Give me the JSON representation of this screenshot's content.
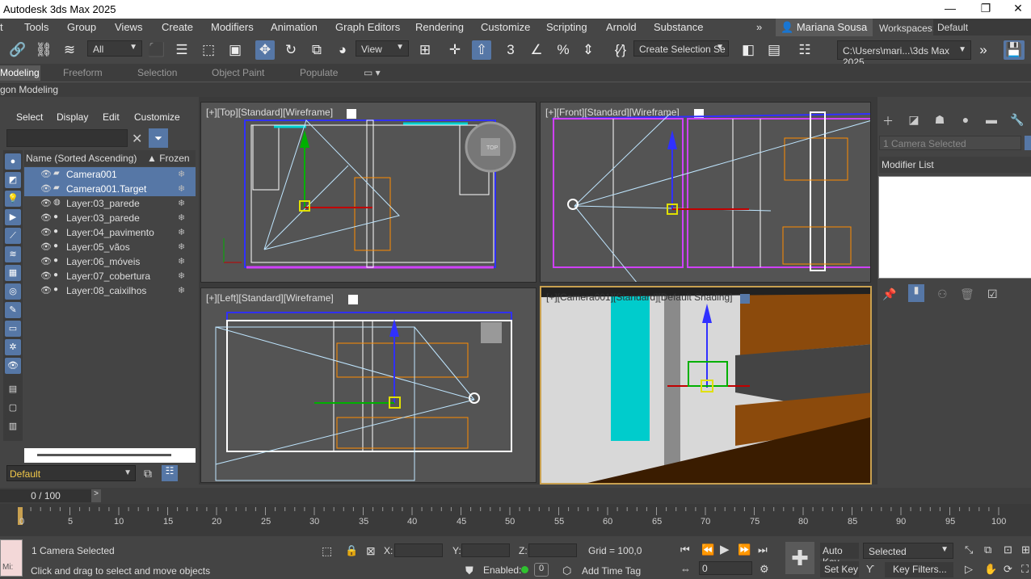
{
  "title": "Autodesk 3ds Max 2025",
  "menu": [
    "Tools",
    "Group",
    "Views",
    "Create",
    "Modifiers",
    "Animation",
    "Graph Editors",
    "Rendering",
    "Customize",
    "Scripting",
    "Arnold",
    "Substance"
  ],
  "user": "Mariana Sousa ▾",
  "workspace_label": "Workspaces:",
  "workspace": "Default",
  "toolbar": {
    "filter": "All",
    "refcoord": "View",
    "selset": "Create Selection Se",
    "path": "C:\\Users\\mari...\\3ds Max 2025"
  },
  "ribbon_tabs": [
    "Modeling",
    "Freeform",
    "Selection",
    "Object Paint",
    "Populate"
  ],
  "ribbon_sub": "gon Modeling",
  "scene": {
    "tabs": [
      "Select",
      "Display",
      "Edit",
      "Customize"
    ],
    "col_name": "Name (Sorted Ascending)",
    "col_frozen": "▲ Frozen",
    "layer": "Default",
    "rows": [
      "Camera001",
      "Camera001.Target",
      "Layer:03_parede",
      "Layer:03_parede",
      "Layer:04_pavimento",
      "Layer:05_vãos",
      "Layer:06_móveis",
      "Layer:07_cobertura",
      "Layer:08_caixilhos"
    ]
  },
  "viewports": {
    "top": "[+][Top][Standard][Wireframe]",
    "front": "[+][Front][Standard][Wireframe]",
    "left": "[+][Left][Standard][Wireframe]",
    "cam": "[+][Camera001][Standard][Default Shading]"
  },
  "cmd": {
    "camsel": "1 Camera Selected",
    "modlist": "Modifier List"
  },
  "time": {
    "slider": "0 / 100",
    "ticks": [
      "0",
      "5",
      "10",
      "15",
      "20",
      "25",
      "30",
      "35",
      "40",
      "45",
      "50",
      "55",
      "60",
      "65",
      "70",
      "75",
      "80",
      "85",
      "90",
      "95",
      "100"
    ]
  },
  "status": {
    "sel": "1 Camera Selected",
    "prompt": "Click and drag to select and move objects",
    "x": "X:",
    "y": "Y:",
    "z": "Z:",
    "grid": "Grid = 100,0",
    "enabled": "Enabled:",
    "addtag": "Add Time Tag",
    "autokey": "Auto Key",
    "setkey": "Set Key",
    "selected": "Selected",
    "keyfilters": "Key Filters...",
    "frame": "0",
    "mini": "Mi:"
  }
}
